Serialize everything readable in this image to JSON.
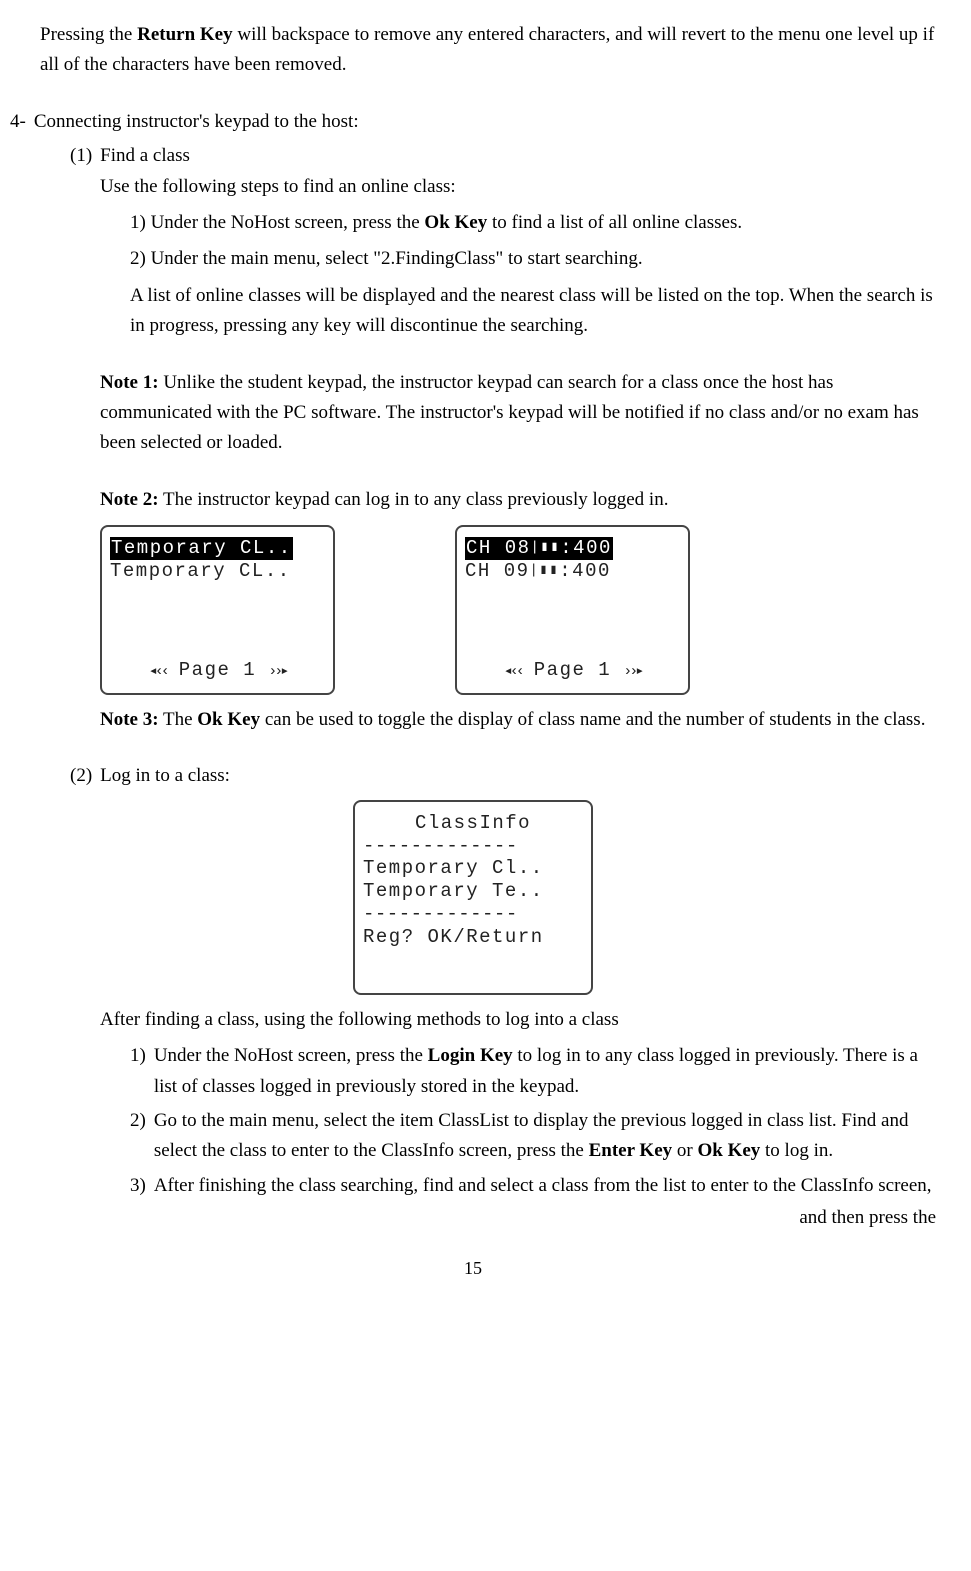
{
  "intro": {
    "pre": "Pressing the ",
    "bold": "Return Key",
    "post": " will backspace to remove any entered characters, and will revert to the menu one level up if all of the characters have been removed."
  },
  "section4": {
    "num": "4-",
    "title": "Connecting instructor's keypad to the host:",
    "item1": {
      "num": "(1)",
      "title": "Find a class",
      "lead": "Use the following steps to find an online class:",
      "step1_pre": "1) Under the NoHost screen, press the ",
      "step1_bold": "Ok Key",
      "step1_post": " to find a list of all online classes.",
      "step2": "2) Under the main menu, select \"2.FindingClass\" to start searching.",
      "afterlist": "A list of online classes will be displayed and the nearest class will be listed on the top. When the search is in progress, pressing any key will discontinue the searching.",
      "note1_label": "Note 1:",
      "note1_text": " Unlike the student keypad, the instructor keypad can search for a class once the host has communicated with the PC software. The instructor's keypad will be notified if no class and/or no exam has been selected or loaded.",
      "note2_label": "Note 2:",
      "note2_text": " The instructor keypad can log in to any class previously logged in.",
      "note3_label": "Note 3:",
      "note3_pre": " The ",
      "note3_bold": "Ok Key",
      "note3_post": " can be used to toggle the display of class name and the number of students in the class."
    },
    "item2": {
      "num": "(2)",
      "title": "Log in to a class:",
      "lead": "After finding a class, using the following methods to log into a class",
      "step1_num": "1)",
      "step1_pre": "Under the NoHost screen, press the ",
      "step1_bold": "Login Key",
      "step1_post": " to log in to any class logged in previously. There is a list of classes logged in previously stored in the keypad.",
      "step2_num": "2)",
      "step2_pre": "Go to the main menu, select the item ClassList to display the previous logged in class list. Find and select the class to enter to the ClassInfo screen, press the ",
      "step2_bold1": "Enter Key",
      "step2_mid": " or ",
      "step2_bold2": "Ok Key",
      "step2_post": " to log in.",
      "step3_num": "3)",
      "step3a": "After finishing the class searching, find and select a class from the list to enter to the ClassInfo screen,",
      "step3b": "and then press the"
    }
  },
  "screens": {
    "left": {
      "line1": "Temporary CL..",
      "line2": "Temporary CL..",
      "page": "Page 1"
    },
    "right": {
      "line1a": "CH 08",
      "line1b": ":400",
      "line2a": "CH 09",
      "line2b": ":400",
      "page": "Page 1"
    },
    "classinfo": {
      "title": "ClassInfo",
      "dashes": "-------------",
      "l1": "Temporary Cl..",
      "l2": "Temporary Te..",
      "foot": "Reg? OK/Return"
    }
  },
  "page_number": "15"
}
